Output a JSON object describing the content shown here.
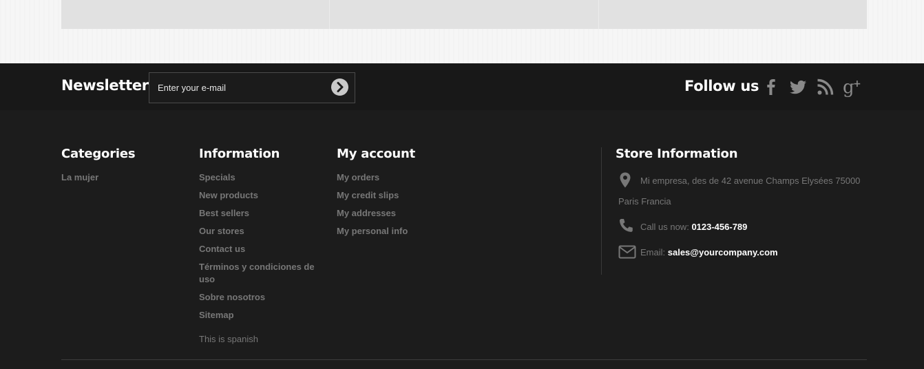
{
  "newsletter": {
    "title": "Newsletter",
    "placeholder": "Enter your e-mail",
    "submit_icon": "arrow-right-circle-icon"
  },
  "follow": {
    "title": "Follow us",
    "icons": [
      "facebook-icon",
      "twitter-icon",
      "rss-icon",
      "google-plus-icon"
    ]
  },
  "categories": {
    "title": "Categories",
    "items": [
      "La mujer"
    ]
  },
  "information": {
    "title": "Information",
    "items": [
      "Specials",
      "New products",
      "Best sellers",
      "Our stores",
      "Contact us",
      "Términos y condiciones de uso",
      "Sobre nosotros",
      "Sitemap"
    ],
    "note": "This is spanish"
  },
  "account": {
    "title": "My account",
    "items": [
      "My orders",
      "My credit slips",
      "My addresses",
      "My personal info"
    ]
  },
  "store": {
    "title": "Store Information",
    "address_line1": "Mi empresa, des de 42 avenue Champs Elysées 75000",
    "address_line2": "Paris Francia",
    "phone_label": "Call us now:",
    "phone": "0123-456-789",
    "email_label": "Email:",
    "email": "sales@yourcompany.com"
  },
  "colors": {
    "footer_bg": "#1c1c1c",
    "newsletter_bg": "#181818",
    "link": "#777777",
    "heading": "#ffffff"
  }
}
